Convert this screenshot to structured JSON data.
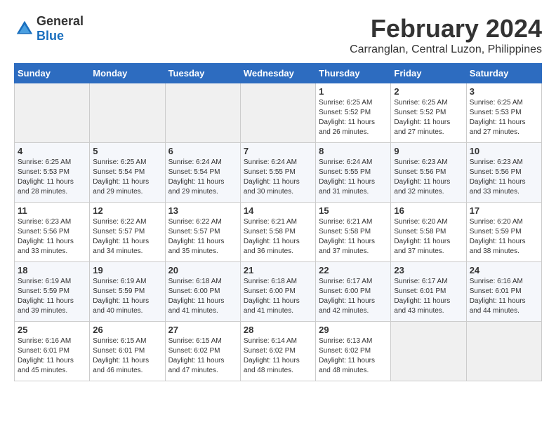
{
  "header": {
    "logo_general": "General",
    "logo_blue": "Blue",
    "month_year": "February 2024",
    "location": "Carranglan, Central Luzon, Philippines"
  },
  "weekdays": [
    "Sunday",
    "Monday",
    "Tuesday",
    "Wednesday",
    "Thursday",
    "Friday",
    "Saturday"
  ],
  "weeks": [
    [
      {
        "day": "",
        "empty": true
      },
      {
        "day": "",
        "empty": true
      },
      {
        "day": "",
        "empty": true
      },
      {
        "day": "",
        "empty": true
      },
      {
        "day": "1",
        "sunrise": "6:25 AM",
        "sunset": "5:52 PM",
        "daylight": "11 hours and 26 minutes."
      },
      {
        "day": "2",
        "sunrise": "6:25 AM",
        "sunset": "5:52 PM",
        "daylight": "11 hours and 27 minutes."
      },
      {
        "day": "3",
        "sunrise": "6:25 AM",
        "sunset": "5:53 PM",
        "daylight": "11 hours and 27 minutes."
      }
    ],
    [
      {
        "day": "4",
        "sunrise": "6:25 AM",
        "sunset": "5:53 PM",
        "daylight": "11 hours and 28 minutes."
      },
      {
        "day": "5",
        "sunrise": "6:25 AM",
        "sunset": "5:54 PM",
        "daylight": "11 hours and 29 minutes."
      },
      {
        "day": "6",
        "sunrise": "6:24 AM",
        "sunset": "5:54 PM",
        "daylight": "11 hours and 29 minutes."
      },
      {
        "day": "7",
        "sunrise": "6:24 AM",
        "sunset": "5:55 PM",
        "daylight": "11 hours and 30 minutes."
      },
      {
        "day": "8",
        "sunrise": "6:24 AM",
        "sunset": "5:55 PM",
        "daylight": "11 hours and 31 minutes."
      },
      {
        "day": "9",
        "sunrise": "6:23 AM",
        "sunset": "5:56 PM",
        "daylight": "11 hours and 32 minutes."
      },
      {
        "day": "10",
        "sunrise": "6:23 AM",
        "sunset": "5:56 PM",
        "daylight": "11 hours and 33 minutes."
      }
    ],
    [
      {
        "day": "11",
        "sunrise": "6:23 AM",
        "sunset": "5:56 PM",
        "daylight": "11 hours and 33 minutes."
      },
      {
        "day": "12",
        "sunrise": "6:22 AM",
        "sunset": "5:57 PM",
        "daylight": "11 hours and 34 minutes."
      },
      {
        "day": "13",
        "sunrise": "6:22 AM",
        "sunset": "5:57 PM",
        "daylight": "11 hours and 35 minutes."
      },
      {
        "day": "14",
        "sunrise": "6:21 AM",
        "sunset": "5:58 PM",
        "daylight": "11 hours and 36 minutes."
      },
      {
        "day": "15",
        "sunrise": "6:21 AM",
        "sunset": "5:58 PM",
        "daylight": "11 hours and 37 minutes."
      },
      {
        "day": "16",
        "sunrise": "6:20 AM",
        "sunset": "5:58 PM",
        "daylight": "11 hours and 37 minutes."
      },
      {
        "day": "17",
        "sunrise": "6:20 AM",
        "sunset": "5:59 PM",
        "daylight": "11 hours and 38 minutes."
      }
    ],
    [
      {
        "day": "18",
        "sunrise": "6:19 AM",
        "sunset": "5:59 PM",
        "daylight": "11 hours and 39 minutes."
      },
      {
        "day": "19",
        "sunrise": "6:19 AM",
        "sunset": "5:59 PM",
        "daylight": "11 hours and 40 minutes."
      },
      {
        "day": "20",
        "sunrise": "6:18 AM",
        "sunset": "6:00 PM",
        "daylight": "11 hours and 41 minutes."
      },
      {
        "day": "21",
        "sunrise": "6:18 AM",
        "sunset": "6:00 PM",
        "daylight": "11 hours and 41 minutes."
      },
      {
        "day": "22",
        "sunrise": "6:17 AM",
        "sunset": "6:00 PM",
        "daylight": "11 hours and 42 minutes."
      },
      {
        "day": "23",
        "sunrise": "6:17 AM",
        "sunset": "6:01 PM",
        "daylight": "11 hours and 43 minutes."
      },
      {
        "day": "24",
        "sunrise": "6:16 AM",
        "sunset": "6:01 PM",
        "daylight": "11 hours and 44 minutes."
      }
    ],
    [
      {
        "day": "25",
        "sunrise": "6:16 AM",
        "sunset": "6:01 PM",
        "daylight": "11 hours and 45 minutes."
      },
      {
        "day": "26",
        "sunrise": "6:15 AM",
        "sunset": "6:01 PM",
        "daylight": "11 hours and 46 minutes."
      },
      {
        "day": "27",
        "sunrise": "6:15 AM",
        "sunset": "6:02 PM",
        "daylight": "11 hours and 47 minutes."
      },
      {
        "day": "28",
        "sunrise": "6:14 AM",
        "sunset": "6:02 PM",
        "daylight": "11 hours and 48 minutes."
      },
      {
        "day": "29",
        "sunrise": "6:13 AM",
        "sunset": "6:02 PM",
        "daylight": "11 hours and 48 minutes."
      },
      {
        "day": "",
        "empty": true
      },
      {
        "day": "",
        "empty": true
      }
    ]
  ]
}
